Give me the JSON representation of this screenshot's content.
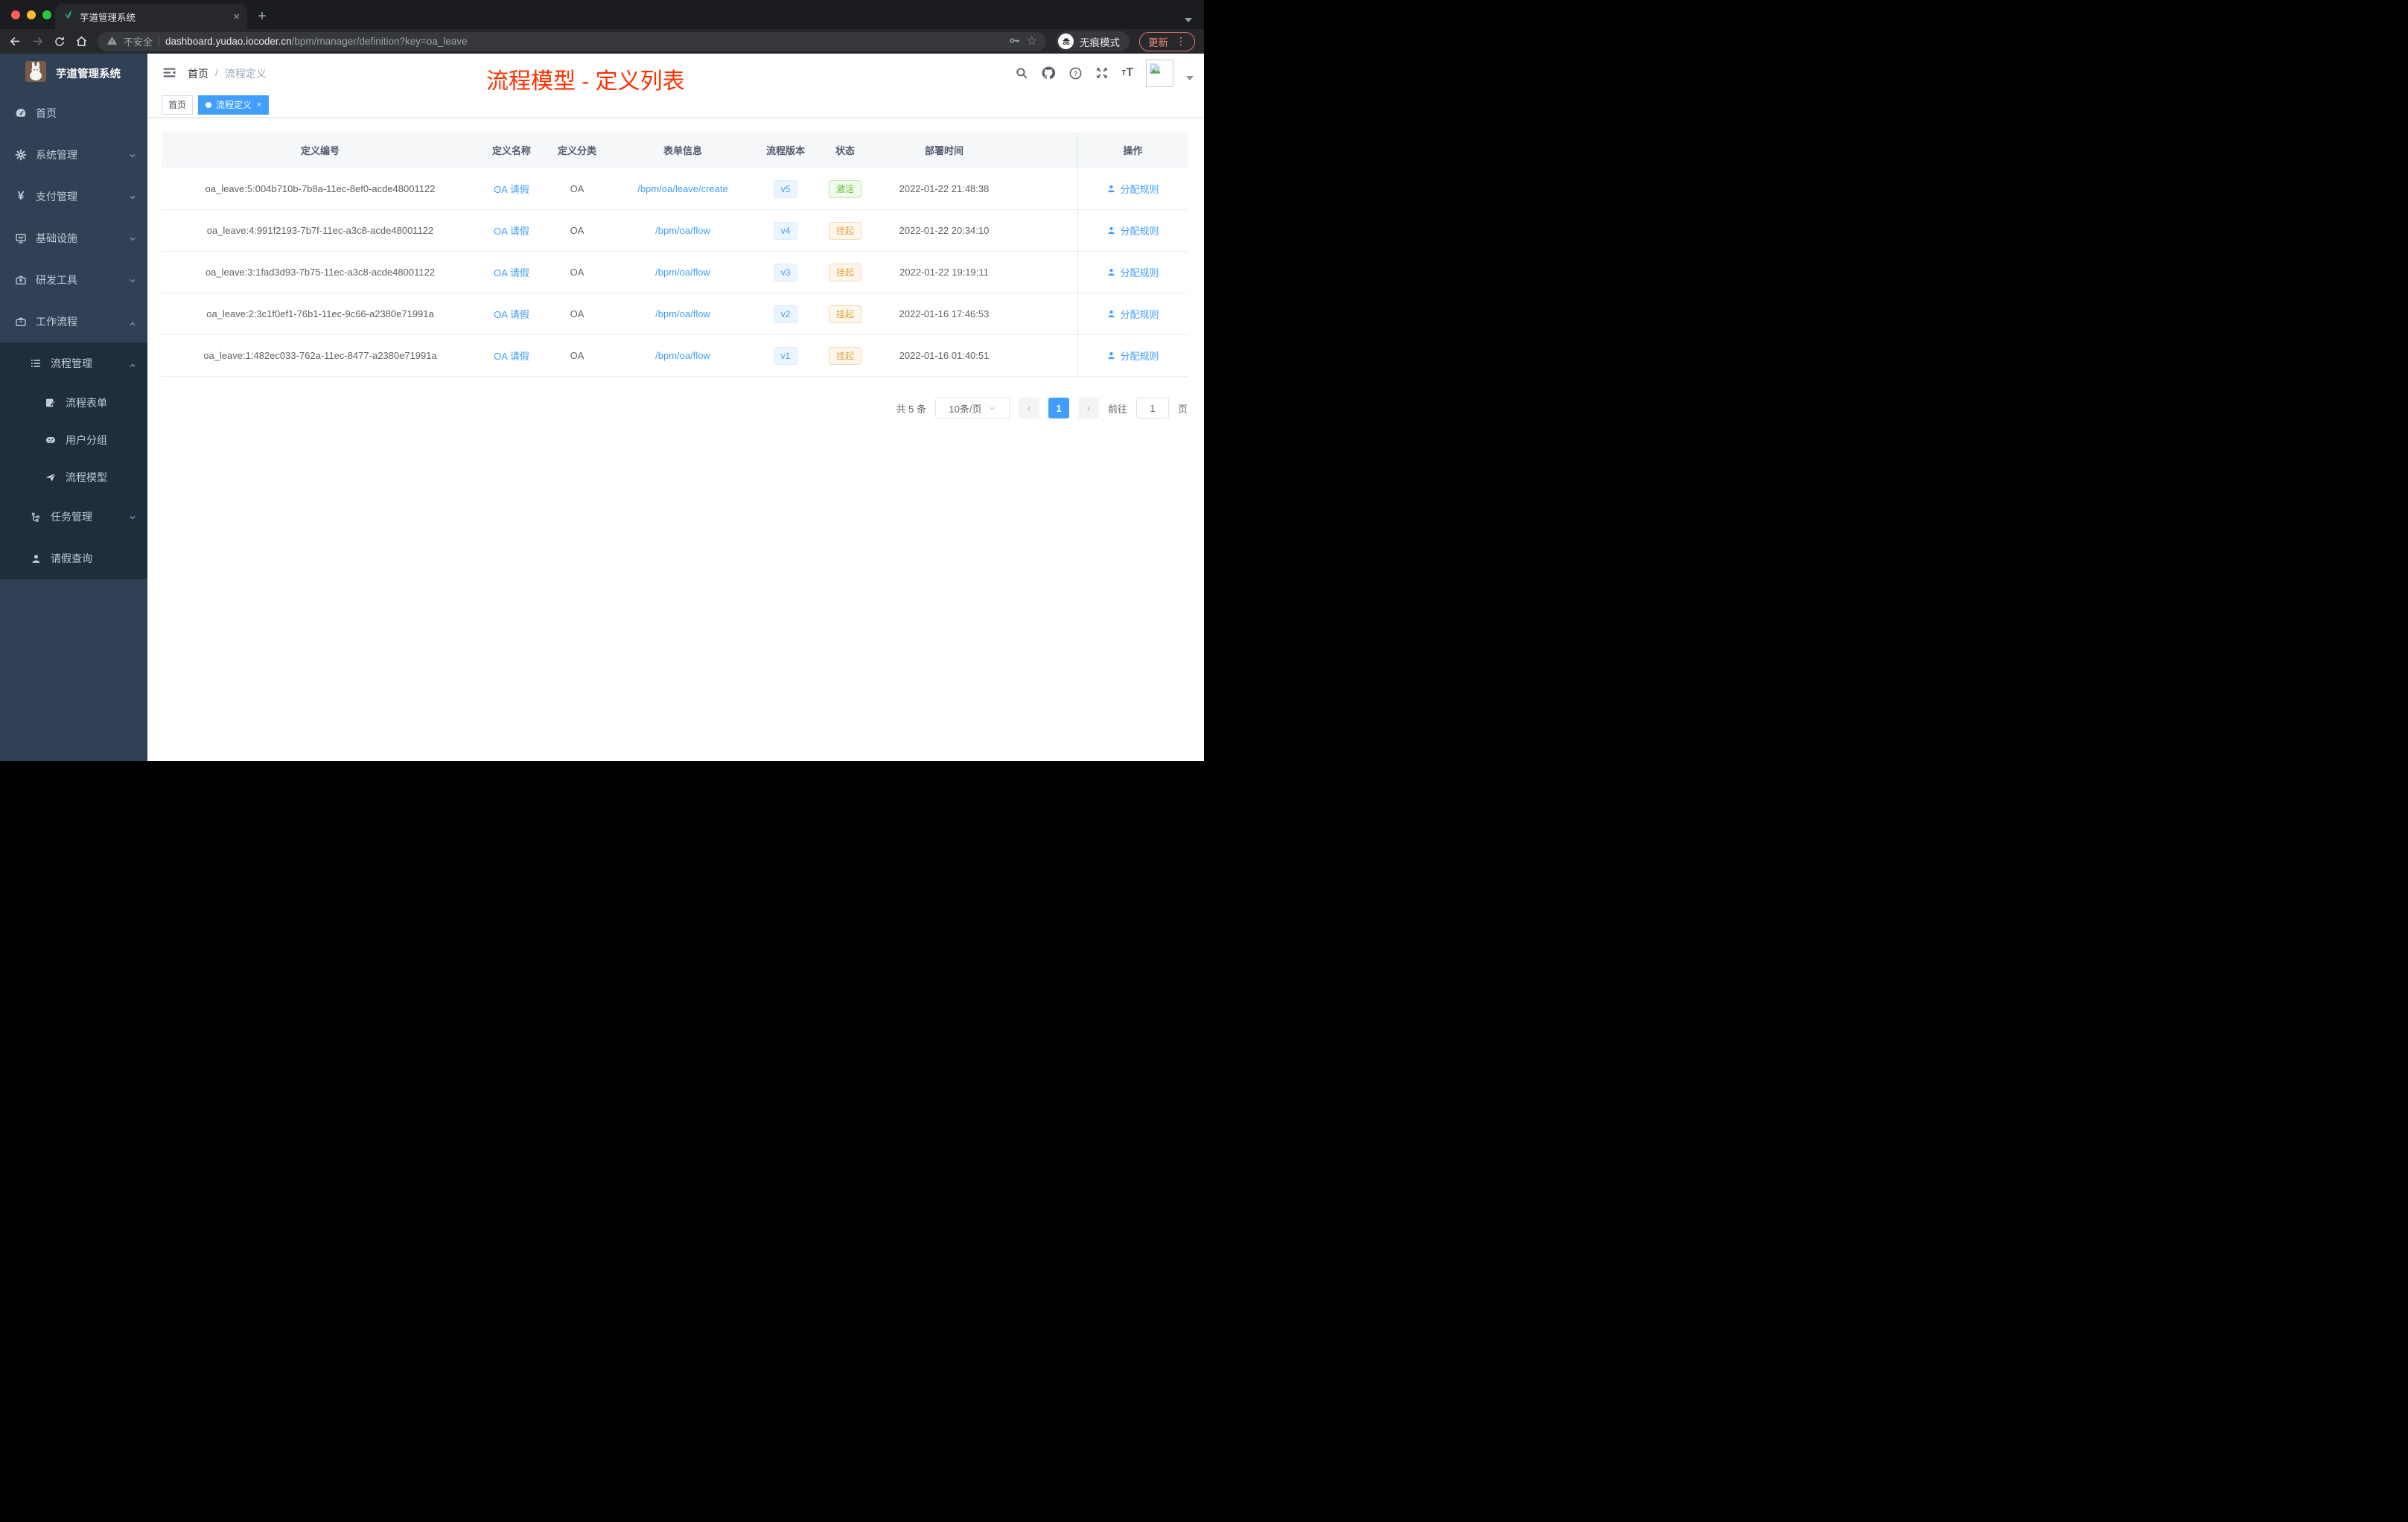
{
  "browser": {
    "tab": {
      "title": "芋道管理系统",
      "favicon": "seedling-icon",
      "close": "×"
    },
    "new_tab_button": "+",
    "security_label": "不安全",
    "url_host": "dashboard.yudao.iocoder.cn",
    "url_path": "/bpm/manager/definition?key=oa_leave",
    "incognito_label": "无痕模式",
    "update_button": "更新",
    "menu_dots": "⋮",
    "star_icon_glyph": "☆"
  },
  "sidebar": {
    "logo_title": "芋道管理系统",
    "items": [
      {
        "label": "首页",
        "icon": "dashboard-icon"
      },
      {
        "label": "系统管理",
        "icon": "gear-icon"
      },
      {
        "label": "支付管理",
        "icon": "yen-icon",
        "glyph": "¥"
      },
      {
        "label": "基础设施",
        "icon": "monitor-icon"
      },
      {
        "label": "研发工具",
        "icon": "toolbox-icon"
      },
      {
        "label": "工作流程",
        "icon": "briefcase-icon"
      }
    ],
    "submenu": {
      "process_group": {
        "label": "流程管理",
        "icon": "list-tree-icon"
      },
      "children": [
        {
          "label": "流程表单",
          "icon": "form-icon"
        },
        {
          "label": "用户分组",
          "icon": "robot-icon"
        },
        {
          "label": "流程模型",
          "icon": "paper-plane-icon"
        }
      ],
      "task_group": {
        "label": "任务管理",
        "icon": "org-tree-icon"
      },
      "leave_item": {
        "label": "请假查询",
        "icon": "user-icon"
      }
    }
  },
  "navbar": {
    "breadcrumb_home": "首页",
    "breadcrumb_sep": "/",
    "breadcrumb_current": "流程定义",
    "icons": [
      "search-icon",
      "github-icon",
      "help-icon",
      "fullscreen-icon",
      "text-size-icon",
      "avatar-broken-image-icon",
      "caret-down-icon"
    ],
    "text_size_small": "T",
    "text_size_big": "T"
  },
  "annotation": {
    "title": "流程模型 - 定义列表"
  },
  "tags": {
    "home": "首页",
    "active": "流程定义",
    "close": "×"
  },
  "table": {
    "columns": [
      "定义编号",
      "定义名称",
      "定义分类",
      "表单信息",
      "流程版本",
      "状态",
      "部署时间",
      "操作"
    ],
    "rows": [
      {
        "id": "oa_leave:5:004b710b-7b8a-11ec-8ef0-acde48001122",
        "name": "OA 请假",
        "category": "OA",
        "form": "/bpm/oa/leave/create",
        "version": "v5",
        "status": "激活",
        "time": "2022-01-22 21:48:38",
        "action": "分配规则"
      },
      {
        "id": "oa_leave:4:991f2193-7b7f-11ec-a3c8-acde48001122",
        "name": "OA 请假",
        "category": "OA",
        "form": "/bpm/oa/flow",
        "version": "v4",
        "status": "挂起",
        "time": "2022-01-22 20:34:10",
        "action": "分配规则"
      },
      {
        "id": "oa_leave:3:1fad3d93-7b75-11ec-a3c8-acde48001122",
        "name": "OA 请假",
        "category": "OA",
        "form": "/bpm/oa/flow",
        "version": "v3",
        "status": "挂起",
        "time": "2022-01-22 19:19:11",
        "action": "分配规则"
      },
      {
        "id": "oa_leave:2:3c1f0ef1-76b1-11ec-9c66-a2380e71991a",
        "name": "OA 请假",
        "category": "OA",
        "form": "/bpm/oa/flow",
        "version": "v2",
        "status": "挂起",
        "time": "2022-01-16 17:46:53",
        "action": "分配规则"
      },
      {
        "id": "oa_leave:1:482ec033-762a-11ec-8477-a2380e71991a",
        "name": "OA 请假",
        "category": "OA",
        "form": "/bpm/oa/flow",
        "version": "v1",
        "status": "挂起",
        "time": "2022-01-16 01:40:51",
        "action": "分配规则"
      }
    ]
  },
  "pagination": {
    "total": "共 5 条",
    "page_size": "10条/页",
    "prev": "‹",
    "page": "1",
    "next": "›",
    "goto_label": "前往",
    "goto_value": "1",
    "unit": "页"
  },
  "colors": {
    "accent": "#409eff",
    "success": "#67c23a",
    "warning": "#e6a23c",
    "annotation_red": "#ff3000",
    "sidebar_bg": "#304156",
    "submenu_bg": "#1f2d3d"
  }
}
